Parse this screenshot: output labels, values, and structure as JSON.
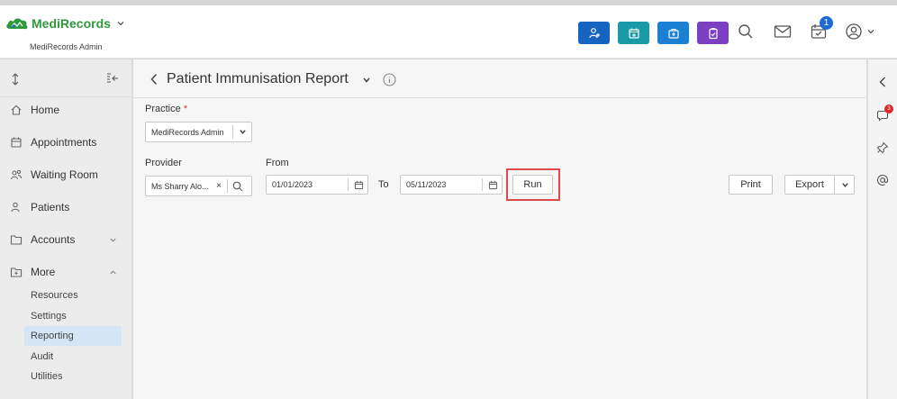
{
  "app": {
    "brand": "MediRecords",
    "subtitle": "MediRecords Admin",
    "notification_count": "1"
  },
  "toolbar": {
    "colors": {
      "add_patient": "#1565c0",
      "calendar": "#1a9aa6",
      "medical": "#1b7fd4",
      "clipboard": "#7c3fc2"
    }
  },
  "sidebar": {
    "items": [
      {
        "label": "Home",
        "icon": "home-icon"
      },
      {
        "label": "Appointments",
        "icon": "calendar-icon"
      },
      {
        "label": "Waiting Room",
        "icon": "people-icon"
      },
      {
        "label": "Patients",
        "icon": "patients-icon"
      },
      {
        "label": "Accounts",
        "icon": "folder-icon"
      },
      {
        "label": "More",
        "icon": "folder-plus-icon"
      }
    ],
    "sub_items": [
      "Resources",
      "Settings",
      "Reporting",
      "Audit",
      "Utilities"
    ],
    "active_sub_item": "Reporting"
  },
  "report": {
    "title": "Patient Immunisation Report",
    "practice_label": "Practice",
    "required_mark": "*",
    "practice_value": "MediRecords Admin",
    "provider_label": "Provider",
    "provider_value": "Ms Sharry Alo...",
    "clear_mark": "×",
    "from_label": "From",
    "from_value": "01/01/2023",
    "to_label": "To",
    "to_value": "05/11/2023",
    "run_label": "Run",
    "print_label": "Print",
    "export_label": "Export"
  },
  "rightbar": {
    "comment_count": "3"
  }
}
